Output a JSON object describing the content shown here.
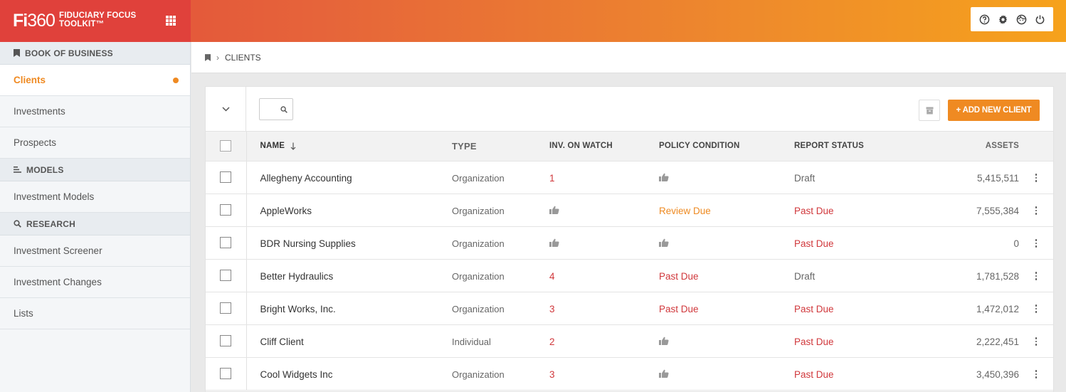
{
  "app": {
    "logo_bold": "Fi",
    "logo_light": "360",
    "product_line1": "FIDUCIARY FOCUS",
    "product_line2": "TOOLKIT™"
  },
  "top_tools": [
    {
      "icon": "help-icon"
    },
    {
      "icon": "gear-icon"
    },
    {
      "icon": "user-face-icon"
    },
    {
      "icon": "power-icon"
    }
  ],
  "sidebar": {
    "book_of_business": {
      "label": "BOOK OF BUSINESS",
      "items": [
        "Clients",
        "Investments",
        "Prospects"
      ]
    },
    "models": {
      "label": "MODELS",
      "items": [
        "Investment Models"
      ]
    },
    "research": {
      "label": "RESEARCH",
      "items": [
        "Investment Screener",
        "Investment Changes",
        "Lists"
      ]
    }
  },
  "breadcrumb": {
    "current": "CLIENTS"
  },
  "toolbar": {
    "add_label": "+ ADD NEW CLIENT"
  },
  "table": {
    "columns": {
      "name": "NAME",
      "type": "TYPE",
      "watch": "INV. ON WATCH",
      "policy": "POLICY CONDITION",
      "report": "REPORT STATUS",
      "assets": "ASSETS"
    },
    "rows": [
      {
        "name": "Allegheny Accounting",
        "type": "Organization",
        "watch": "1",
        "policy": "",
        "report": "Draft",
        "assets": "5,415,511"
      },
      {
        "name": "AppleWorks",
        "type": "Organization",
        "watch": "",
        "policy": "Review Due",
        "report": "Past Due",
        "assets": "7,555,384"
      },
      {
        "name": "BDR Nursing Supplies",
        "type": "Organization",
        "watch": "",
        "policy": "",
        "report": "Past Due",
        "assets": "0"
      },
      {
        "name": "Better Hydraulics",
        "type": "Organization",
        "watch": "4",
        "policy": "Past Due",
        "report": "Draft",
        "assets": "1,781,528"
      },
      {
        "name": "Bright Works, Inc.",
        "type": "Organization",
        "watch": "3",
        "policy": "Past Due",
        "report": "Past Due",
        "assets": "1,472,012"
      },
      {
        "name": "Cliff Client",
        "type": "Individual",
        "watch": "2",
        "policy": "",
        "report": "Past Due",
        "assets": "2,222,451"
      },
      {
        "name": "Cool Widgets Inc",
        "type": "Organization",
        "watch": "3",
        "policy": "",
        "report": "Past Due",
        "assets": "3,450,396"
      }
    ]
  },
  "colors": {
    "accent": "#ef8a22",
    "danger": "#d0373b",
    "brand": "#e0413b"
  }
}
